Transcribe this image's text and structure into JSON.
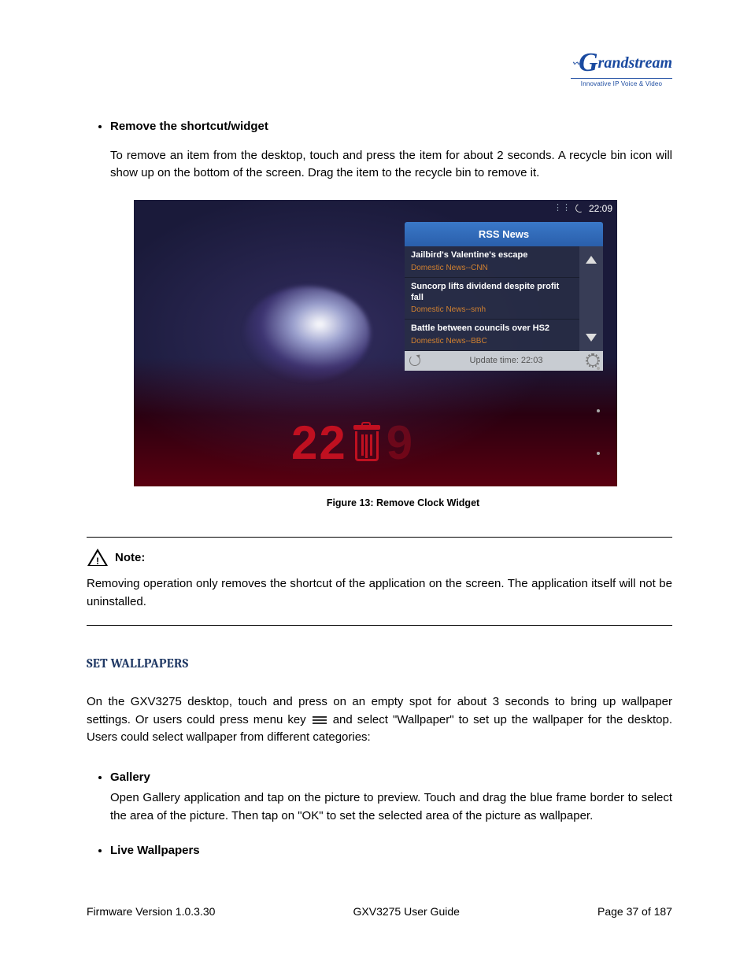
{
  "logo": {
    "brand": "Grandstream",
    "tag": "Innovative IP Voice & Video"
  },
  "sections": {
    "remove": {
      "title": "Remove the shortcut/widget",
      "body": "To remove an item from the desktop, touch and press the item for about 2 seconds. A recycle bin icon will show up on the bottom of the screen. Drag the item to the recycle bin to remove it."
    }
  },
  "screenshot": {
    "status_time": "22:09",
    "rss_title": "RSS News",
    "items": [
      {
        "t": "Jailbird's Valentine's escape",
        "s": "Domestic News--CNN"
      },
      {
        "t": "Suncorp lifts dividend despite profit fall",
        "s": "Domestic News--smh"
      },
      {
        "t": "Battle between councils over HS2",
        "s": "Domestic News--BBC"
      }
    ],
    "update_label": "Update time: 22:03",
    "clock_left": "22",
    "clock_right": "9"
  },
  "caption": "Figure 13: Remove Clock Widget",
  "note": {
    "label": "Note:",
    "body": "Removing operation only removes the shortcut of the application on the screen. The application itself will not be uninstalled."
  },
  "wallpapers": {
    "heading": "SET WALLPAPERS",
    "intro_a": "On the GXV3275 desktop, touch and press on an empty spot for about 3 seconds to bring up wallpaper settings. Or users could press menu key ",
    "intro_b": " and select \"Wallpaper\" to set up the wallpaper for the desktop. Users could select wallpaper from different categories:",
    "gallery": {
      "title": "Gallery",
      "body": "Open Gallery application and tap on the picture to preview. Touch and drag the blue frame border to select the area of the picture. Then tap on \"OK\" to set the selected area of the picture as wallpaper."
    },
    "live": {
      "title": "Live Wallpapers"
    }
  },
  "footer": {
    "left": "Firmware Version 1.0.3.30",
    "center": "GXV3275 User Guide",
    "right": "Page 37 of 187"
  }
}
